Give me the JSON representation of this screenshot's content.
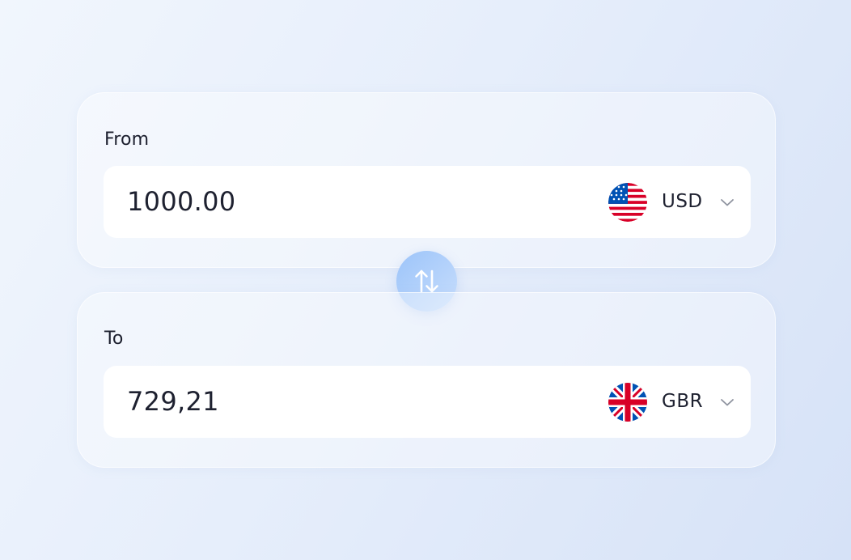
{
  "converter": {
    "from": {
      "label": "From",
      "amount": "1000.00",
      "currency_code": "USD",
      "flag_icon": "us-flag-icon"
    },
    "to": {
      "label": "To",
      "amount": "729,21",
      "currency_code": "GBR",
      "flag_icon": "uk-flag-icon"
    },
    "swap_icon": "swap-arrows-icon"
  },
  "colors": {
    "text": "#1c1f2e",
    "swap_button": "#aacbfa",
    "field_background": "#ffffff"
  }
}
